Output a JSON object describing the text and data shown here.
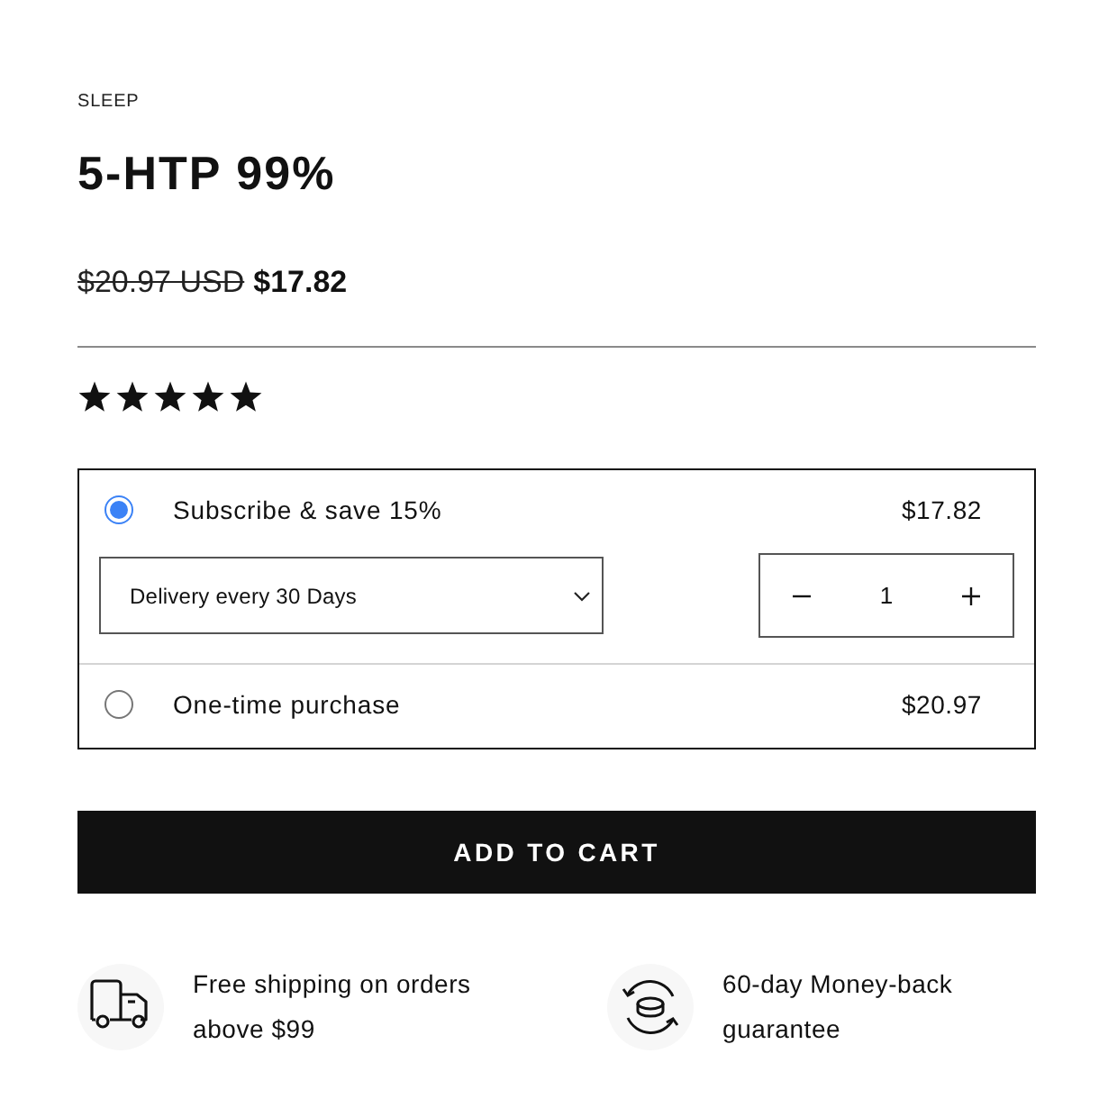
{
  "category": "SLEEP",
  "title": "5-HTP 99%",
  "price": {
    "compare_at": "$20.97 USD",
    "current": "$17.82"
  },
  "rating": {
    "stars": 5
  },
  "purchase_options": [
    {
      "kind": "subscription",
      "label": "Subscribe & save 15%",
      "price": "$17.82",
      "selected": true,
      "delivery": {
        "value": "Delivery every 30 Days"
      },
      "quantity": {
        "value": "1"
      }
    },
    {
      "kind": "one_time",
      "label": "One-time purchase",
      "price": "$20.97",
      "selected": false
    }
  ],
  "add_to_cart": {
    "label": "ADD TO CART"
  },
  "features": [
    {
      "kind": "shipping",
      "text": "Free shipping on orders above $99"
    },
    {
      "kind": "guarantee",
      "text": "60-day Money-back guarantee"
    }
  ]
}
